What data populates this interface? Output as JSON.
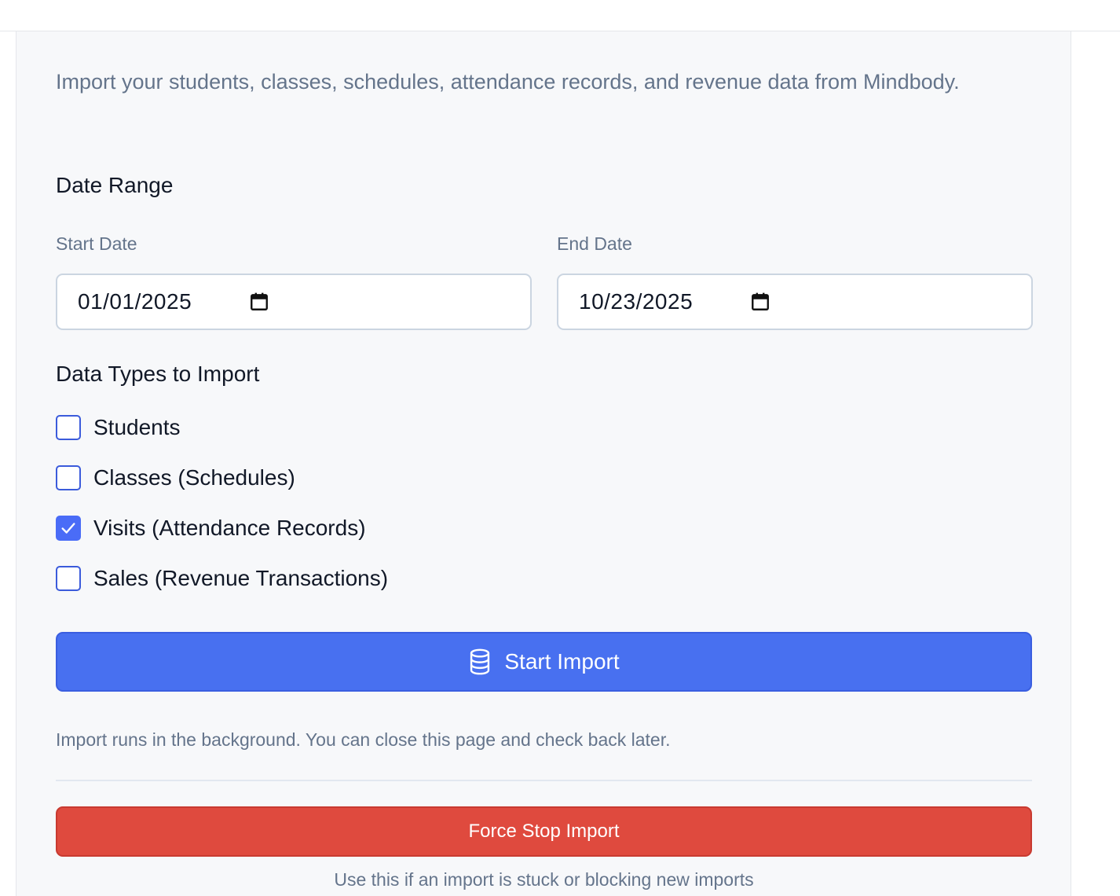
{
  "intro": "Import your students, classes, schedules, attendance records, and revenue data from Mindbody.",
  "date_range": {
    "title": "Date Range",
    "start_label": "Start Date",
    "start_value": "01/01/2025",
    "end_label": "End Date",
    "end_value": "10/23/2025",
    "calendar_icon": "calendar-icon"
  },
  "data_types": {
    "title": "Data Types to Import",
    "items": [
      {
        "label": "Students",
        "checked": false
      },
      {
        "label": "Classes (Schedules)",
        "checked": false
      },
      {
        "label": "Visits (Attendance Records)",
        "checked": true
      },
      {
        "label": "Sales (Revenue Transactions)",
        "checked": false
      }
    ]
  },
  "start_button": {
    "label": "Start Import",
    "icon": "database-icon"
  },
  "hint": "Import runs in the background. You can close this page and check back later.",
  "force_stop": {
    "label": "Force Stop Import",
    "note": "Use this if an import is stuck or blocking new imports"
  },
  "colors": {
    "primary": "#4870f0",
    "danger": "#df4a3e",
    "checkbox": "#4a6cf7",
    "muted_text": "#64748b"
  }
}
